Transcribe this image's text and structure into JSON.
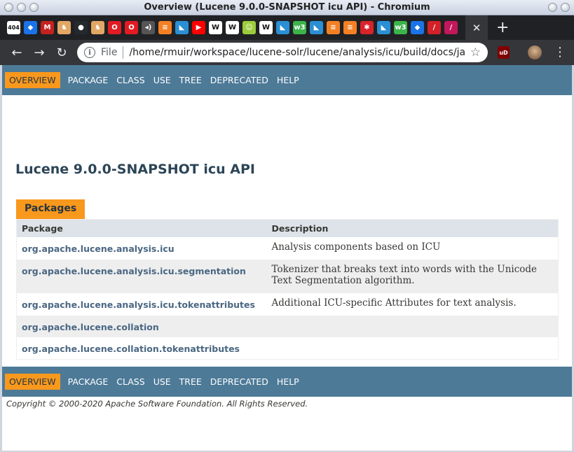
{
  "window": {
    "title": "Overview (Lucene 9.0.0-SNAPSHOT icu API) - Chromium"
  },
  "tabs": {
    "favicons": [
      {
        "icon": "gmail-404-icon",
        "label": "404",
        "color": "#ffffff"
      },
      {
        "icon": "diamond-icon",
        "label": "◆",
        "color": "#1a73e8"
      },
      {
        "icon": "gmail-icon",
        "label": "M",
        "color": "#c5221f"
      },
      {
        "icon": "horse-icon",
        "label": "♞",
        "color": "#e2a765"
      },
      {
        "icon": "github-icon",
        "label": "●",
        "color": "#24292e"
      },
      {
        "icon": "horse-icon",
        "label": "♞",
        "color": "#e2a765"
      },
      {
        "icon": "oracle-icon",
        "label": "O",
        "color": "#e21b23"
      },
      {
        "icon": "oracle-icon",
        "label": "O",
        "color": "#e21b23"
      },
      {
        "icon": "speaker-icon",
        "label": "◂)",
        "color": "#555555"
      },
      {
        "icon": "stackoverflow-icon",
        "label": "≡",
        "color": "#f48024"
      },
      {
        "icon": "bird-icon",
        "label": "◣",
        "color": "#2a8fd4"
      },
      {
        "icon": "youtube-icon",
        "label": "▶",
        "color": "#ff0000"
      },
      {
        "icon": "wikipedia-icon",
        "label": "W",
        "color": "#ffffff"
      },
      {
        "icon": "wikipedia-icon",
        "label": "W",
        "color": "#ffffff"
      },
      {
        "icon": "smiley-icon",
        "label": "☺",
        "color": "#9ccc3c"
      },
      {
        "icon": "wikipedia-icon",
        "label": "W",
        "color": "#ffffff"
      },
      {
        "icon": "bird-icon",
        "label": "◣",
        "color": "#2a8fd4"
      },
      {
        "icon": "w3-icon",
        "label": "w3",
        "color": "#3bb44a"
      },
      {
        "icon": "bird-icon",
        "label": "◣",
        "color": "#2a8fd4"
      },
      {
        "icon": "stackoverflow-icon",
        "label": "≡",
        "color": "#f48024"
      },
      {
        "icon": "stackoverflow-icon",
        "label": "≡",
        "color": "#f48024"
      },
      {
        "icon": "asterisk-icon",
        "label": "✱",
        "color": "#d9232b"
      },
      {
        "icon": "bird-icon",
        "label": "◣",
        "color": "#2a8fd4"
      },
      {
        "icon": "w3-icon",
        "label": "w3",
        "color": "#3bb44a"
      },
      {
        "icon": "diamond-icon",
        "label": "◆",
        "color": "#1a73e8"
      },
      {
        "icon": "feather-icon",
        "label": "/",
        "color": "#d22128"
      },
      {
        "icon": "feather-icon",
        "label": "/",
        "color": "#c2185b"
      }
    ],
    "active_close": "✕",
    "new_tab": "+"
  },
  "toolbar": {
    "scheme": "File",
    "url": "/home/rmuir/workspace/lucene-solr/lucene/analysis/icu/build/docs/javad...",
    "ublock_label": "uD"
  },
  "nav": {
    "items": [
      "OVERVIEW",
      "PACKAGE",
      "CLASS",
      "USE",
      "TREE",
      "DEPRECATED",
      "HELP"
    ],
    "active_index": 0
  },
  "content": {
    "title": "Lucene 9.0.0-SNAPSHOT icu API",
    "caption": "Packages",
    "table": {
      "headers": [
        "Package",
        "Description"
      ],
      "rows": [
        {
          "package": "org.apache.lucene.analysis.icu",
          "description": "Analysis components based on ICU"
        },
        {
          "package": "org.apache.lucene.analysis.icu.segmentation",
          "description": "Tokenizer that breaks text into words with the Unicode Text Segmentation algorithm."
        },
        {
          "package": "org.apache.lucene.analysis.icu.tokenattributes",
          "description": "Additional ICU-specific Attributes for text analysis."
        },
        {
          "package": "org.apache.lucene.collation",
          "description": ""
        },
        {
          "package": "org.apache.lucene.collation.tokenattributes",
          "description": ""
        }
      ]
    },
    "copyright": "Copyright © 2000-2020 Apache Software Foundation. All Rights Reserved."
  },
  "colors": {
    "nav_bg": "#4d7a97",
    "nav_active": "#f8981d",
    "title": "#2c4557",
    "link": "#4a6782"
  }
}
